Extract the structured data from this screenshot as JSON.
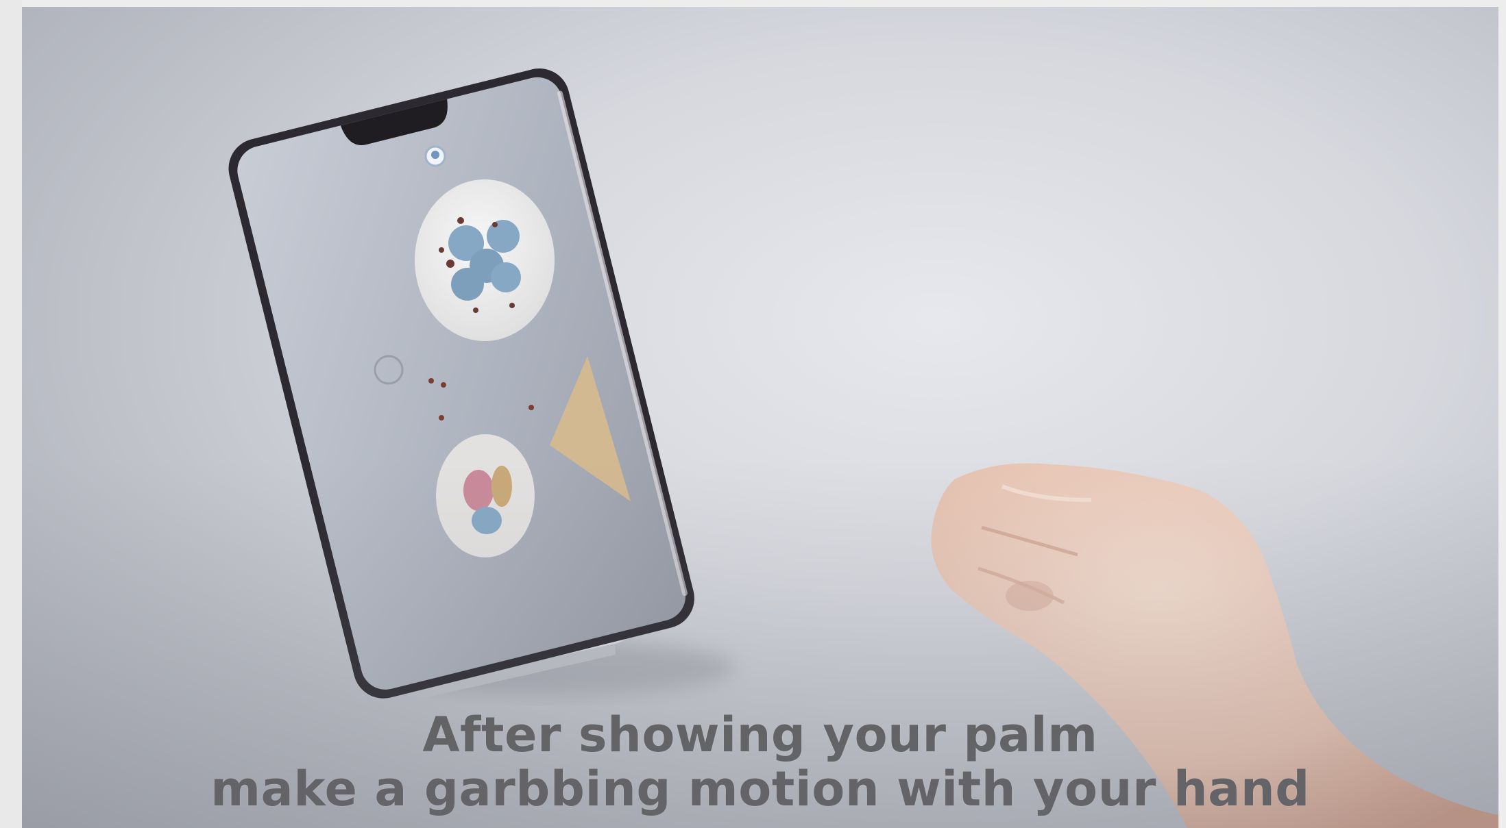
{
  "video_frame": {
    "subtitle": {
      "line1": "After showing your palm",
      "line2": "make a garbbing motion with your hand"
    }
  },
  "scene": {
    "objects": [
      "phone",
      "phone-stand",
      "plate-macarons",
      "plate-pink-macarons",
      "napkin",
      "selfie-camera-icon",
      "hand-fist"
    ]
  },
  "colors": {
    "background": "#d6d8de",
    "subtitle_text": "#5e5e60",
    "phone_frame": "#2c2a30",
    "macaron_blue": "#86a8c4",
    "macaron_pink": "#c98a9a",
    "napkin": "#d3b992",
    "skin": "#e8c9b8"
  }
}
